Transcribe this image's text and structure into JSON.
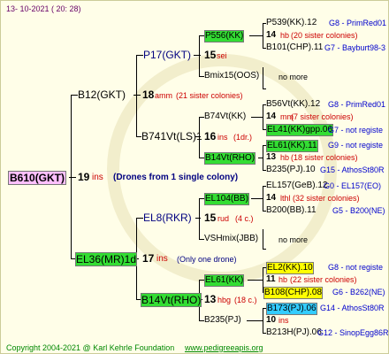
{
  "date_line": "13- 10-2021 ( 20: 28)",
  "footer": {
    "copyright": "Copyright 2004-2021 @ Karl Kehrle Foundation",
    "site": "www.pedigreeapis.org"
  },
  "root": {
    "name": "B610(GKT)",
    "num": "19",
    "ins": "ins",
    "note": "(Drones from 1 single colony)"
  },
  "b12": {
    "name": "B12(GKT)",
    "num": "18",
    "ins": "amm",
    "sis": "(21 sister colonies)"
  },
  "p17": {
    "name": "P17(GKT)"
  },
  "p556": {
    "name": "P556(KK)",
    "num": "14",
    "ins": "hb",
    "sis": "(20 sister colonies)",
    "rel": "G8 - PrimRed01"
  },
  "p539": {
    "name": "P539(KK).12"
  },
  "b101": {
    "name": "B101(CHP).11",
    "rel": "G7 - Bayburt98-3"
  },
  "gen15a": {
    "num": "15",
    "ins": "sei"
  },
  "bmix15": {
    "name": "Bmix15(OOS)",
    "more": "no more"
  },
  "b741": {
    "name": "B741Vt(LS)1",
    "num": "16",
    "ins": "ins",
    "sis": "(1dr.)"
  },
  "b74a": {
    "name": "B74Vt(KK)"
  },
  "b56": {
    "name": "B56Vt(KK).12",
    "rel": "G8 - PrimRed01"
  },
  "g14b": {
    "num": "14",
    "ins": "mm",
    "sis": "(7 sister colonies)"
  },
  "el41": {
    "name": "EL41(KK)gpp.06",
    "rel": "G7 - not registe"
  },
  "b14a": {
    "name": "B14Vt(RHO)"
  },
  "el61a": {
    "name": "EL61(KK).11",
    "rel": "G9 - not registe"
  },
  "g13a": {
    "num": "13",
    "ins": "hb",
    "sis": "(18 sister colonies)"
  },
  "b235a": {
    "name": "B235(PJ).10",
    "rel": "G15 - AthosSt80R"
  },
  "el36": {
    "name": "EL36(MR)1d",
    "num": "17",
    "ins": "ins",
    "note": "(Only one drone)"
  },
  "el8": {
    "name": "EL8(RKR)"
  },
  "el104": {
    "name": "EL104(BB)"
  },
  "el157": {
    "name": "EL157(GeB).12",
    "rel": "G0 - EL157(EO)"
  },
  "g14c": {
    "num": "14",
    "ins": "lthl",
    "sis": "(32 sister colonies)"
  },
  "b200": {
    "name": "B200(BB).11",
    "rel": "G5 - B200(NE)"
  },
  "g15b": {
    "num": "15",
    "ins": "rud",
    "sis": "(4 c.)"
  },
  "vshmix": {
    "name": "VSHmix(JBB)",
    "more": "no more"
  },
  "b14b": {
    "name": "B14Vt(RHO)",
    "num": "13",
    "ins": "hbg",
    "sis": "(18 c.)"
  },
  "el61b": {
    "name": "EL61(KK)"
  },
  "el2": {
    "name": "EL2(KK).10",
    "rel": "G8 - not registe"
  },
  "g11": {
    "num": "11",
    "ins": "hb",
    "sis": "(22 sister colonies)"
  },
  "b108": {
    "name": "B108(CHP).08",
    "rel": "G6 - B262(NE)"
  },
  "b235b": {
    "name": "B235(PJ)"
  },
  "b173": {
    "name": "B173(PJ).06",
    "rel": "G14 - AthosSt80R"
  },
  "g10": {
    "num": "10",
    "ins": "ins"
  },
  "b213": {
    "name": "B213H(PJ).06",
    "rel": "G12 - SinopEgg86R"
  }
}
